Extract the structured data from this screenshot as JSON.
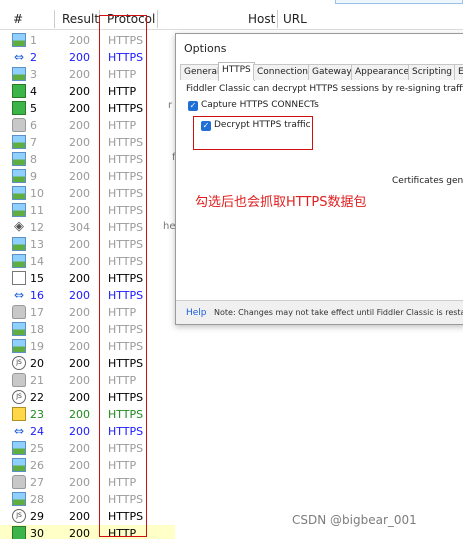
{
  "header": {
    "num": "#",
    "result": "Result",
    "protocol": "Protocol",
    "host": "Host",
    "url": "URL"
  },
  "sessions": [
    {
      "num": "1",
      "result": "200",
      "protocol": "HTTPS",
      "icon": "image-icon",
      "color": "gray"
    },
    {
      "num": "2",
      "result": "200",
      "protocol": "HTTPS",
      "icon": "arrows-icon",
      "color": "blue"
    },
    {
      "num": "3",
      "result": "200",
      "protocol": "HTTP",
      "icon": "image-icon",
      "color": "gray"
    },
    {
      "num": "4",
      "result": "200",
      "protocol": "HTTP",
      "icon": "green-doc-icon",
      "color": "black"
    },
    {
      "num": "5",
      "result": "200",
      "protocol": "HTTPS",
      "icon": "green-doc-icon",
      "color": "black"
    },
    {
      "num": "6",
      "result": "200",
      "protocol": "HTTP",
      "icon": "lock-icon",
      "color": "gray"
    },
    {
      "num": "7",
      "result": "200",
      "protocol": "HTTPS",
      "icon": "image-icon",
      "color": "gray"
    },
    {
      "num": "8",
      "result": "200",
      "protocol": "HTTPS",
      "icon": "image-icon",
      "color": "gray"
    },
    {
      "num": "9",
      "result": "200",
      "protocol": "HTTPS",
      "icon": "image-icon",
      "color": "gray"
    },
    {
      "num": "10",
      "result": "200",
      "protocol": "HTTPS",
      "icon": "image-icon",
      "color": "gray"
    },
    {
      "num": "11",
      "result": "200",
      "protocol": "HTTPS",
      "icon": "image-icon",
      "color": "gray"
    },
    {
      "num": "12",
      "result": "304",
      "protocol": "HTTPS",
      "icon": "diamond-icon",
      "color": "gray"
    },
    {
      "num": "13",
      "result": "200",
      "protocol": "HTTPS",
      "icon": "image-icon",
      "color": "gray"
    },
    {
      "num": "14",
      "result": "200",
      "protocol": "HTTPS",
      "icon": "image-icon",
      "color": "gray"
    },
    {
      "num": "15",
      "result": "200",
      "protocol": "HTTPS",
      "icon": "doc-icon",
      "color": "black"
    },
    {
      "num": "16",
      "result": "200",
      "protocol": "HTTPS",
      "icon": "arrows-icon",
      "color": "blue"
    },
    {
      "num": "17",
      "result": "200",
      "protocol": "HTTP",
      "icon": "lock-icon",
      "color": "gray"
    },
    {
      "num": "18",
      "result": "200",
      "protocol": "HTTPS",
      "icon": "image-icon",
      "color": "gray"
    },
    {
      "num": "19",
      "result": "200",
      "protocol": "HTTPS",
      "icon": "image-icon",
      "color": "gray"
    },
    {
      "num": "20",
      "result": "200",
      "protocol": "HTTPS",
      "icon": "js-icon",
      "color": "black"
    },
    {
      "num": "21",
      "result": "200",
      "protocol": "HTTP",
      "icon": "lock-icon",
      "color": "gray"
    },
    {
      "num": "22",
      "result": "200",
      "protocol": "HTTPS",
      "icon": "js-icon",
      "color": "black"
    },
    {
      "num": "23",
      "result": "200",
      "protocol": "HTTPS",
      "icon": "yellow-js-icon",
      "color": "green"
    },
    {
      "num": "24",
      "result": "200",
      "protocol": "HTTPS",
      "icon": "arrows-icon",
      "color": "blue"
    },
    {
      "num": "25",
      "result": "200",
      "protocol": "HTTPS",
      "icon": "image-icon",
      "color": "gray"
    },
    {
      "num": "26",
      "result": "200",
      "protocol": "HTTP",
      "icon": "image-icon",
      "color": "gray"
    },
    {
      "num": "27",
      "result": "200",
      "protocol": "HTTP",
      "icon": "lock-icon",
      "color": "gray"
    },
    {
      "num": "28",
      "result": "200",
      "protocol": "HTTPS",
      "icon": "image-icon",
      "color": "gray"
    },
    {
      "num": "29",
      "result": "200",
      "protocol": "HTTPS",
      "icon": "js-icon",
      "color": "black"
    },
    {
      "num": "30",
      "result": "200",
      "protocol": "HTTP",
      "icon": "green-doc-icon",
      "color": "black"
    }
  ],
  "selected_session": "30",
  "options_dialog": {
    "title": "Options",
    "tabs": [
      "General",
      "HTTPS",
      "Connections",
      "Gateway",
      "Appearance",
      "Scripting",
      "Ext"
    ],
    "active_tab": "HTTPS",
    "description": "Fiddler Classic can decrypt HTTPS sessions by re-signing traffic using self-",
    "capture_label": "Capture HTTPS CONNECTs",
    "decrypt_label": "Decrypt HTTPS traffic",
    "certificates_label": "Certificates genera",
    "help_label": "Help",
    "note": "Note: Changes may not take effect until Fiddler Classic is resta"
  },
  "annotation": "勾选后也会抓取HTTPS数据包",
  "watermark": "CSDN @bigbear_001",
  "colors": {
    "highlight_red": "#d01010",
    "annotation_red": "#e02020",
    "selected_row": "#ffffc8",
    "checkbox_blue": "#1f6fd6"
  }
}
